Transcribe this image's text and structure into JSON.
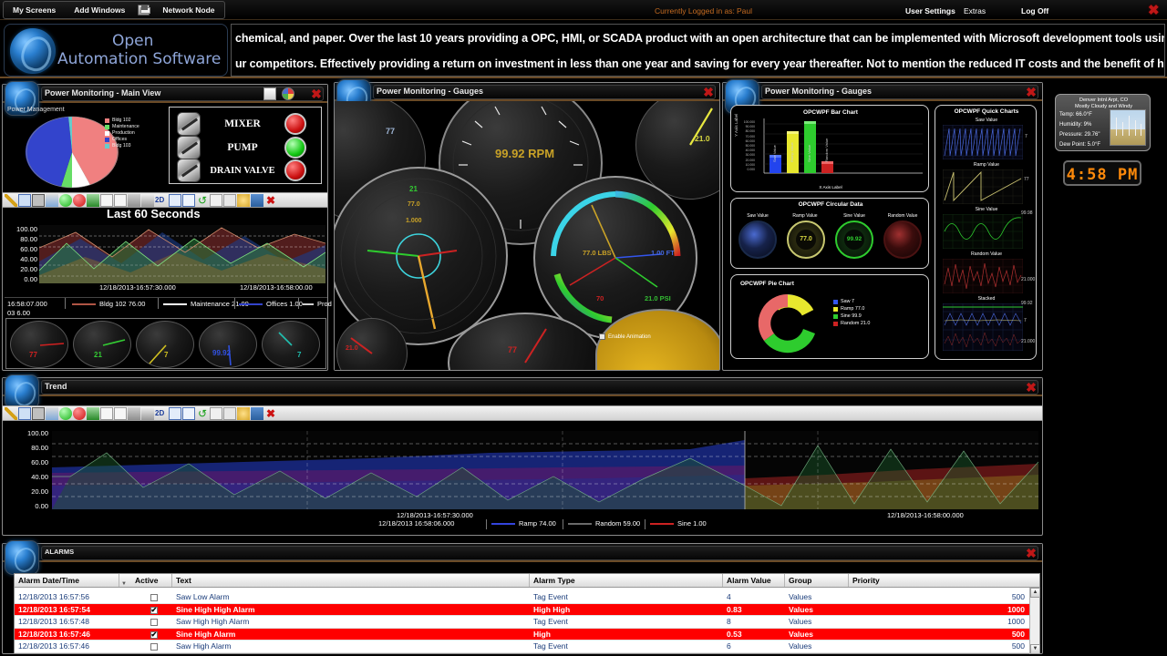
{
  "topbar": {
    "menu": [
      {
        "label": "My Screens",
        "icon": "none"
      },
      {
        "label": "Add Windows",
        "icon": "none"
      },
      {
        "label": "Network Node",
        "icon": "save-icon"
      }
    ],
    "logged_in_label": "Currently Logged in as:",
    "logged_in_user": "Paul",
    "right_items": [
      {
        "label": "User Settings"
      },
      {
        "label": "Extras"
      },
      {
        "label": "Log Off"
      }
    ],
    "close_icon": "close-icon"
  },
  "banner": {
    "logo_line1": "Open",
    "logo_line2": "Automation Software",
    "marquee_line1": "chemical, and paper. Over the last 10 years providing a OPC, HMI, or SCADA product with an open architecture that can be implemented with Microsoft development tools using VB.NET, C",
    "marquee_line2": "ur competitors. Effectively providing a return on investment in less than one year and saving for every year thereafter. Not to mention the reduced IT costs and the benefit of have access t"
  },
  "windows": {
    "main_view": {
      "title": "Power Monitoring - Main View",
      "section_label": "Power Management",
      "pie": {
        "title": "Power Management",
        "legend": [
          {
            "label": "Bldg 102",
            "color": "#f08080"
          },
          {
            "label": "Maintenance",
            "color": "#66dd66"
          },
          {
            "label": "Production",
            "color": "#ffffff"
          },
          {
            "label": "Offices",
            "color": "#3344cc"
          },
          {
            "label": "Bldg 103",
            "color": "#66cccc"
          }
        ]
      },
      "indicators": [
        {
          "name": "MIXER",
          "state": "red"
        },
        {
          "name": "PUMP",
          "state": "green"
        },
        {
          "name": "DRAIN VALVE",
          "state": "red"
        }
      ],
      "trend": {
        "title": "Last 60 Seconds",
        "y_ticks": [
          "100.00",
          "80.00",
          "60.00",
          "40.00",
          "20.00",
          "0.00"
        ],
        "x_ticks": [
          "12/18/2013-16:57:30.000",
          "12/18/2013-16:58:00.00"
        ],
        "legend_time": "16:58:07.000",
        "legend_time2": "03 6.00",
        "legend": [
          {
            "label": "Bldg 102 76.00",
            "color": "#b05545"
          },
          {
            "label": "Maintenance 21.00",
            "color": "#ffffff"
          },
          {
            "label": "Offices 1.00",
            "color": "#3344cc"
          },
          {
            "label": "Prod",
            "color": "#cfcfcf"
          }
        ]
      },
      "mini_gauges": [
        {
          "value": "77",
          "color": "#d02020"
        },
        {
          "value": "21",
          "color": "#33cc33"
        },
        {
          "value": "7",
          "color": "#d0c020"
        },
        {
          "value": "99.92",
          "color": "#3050e0"
        },
        {
          "value": "7",
          "color": "#20c0b0"
        }
      ]
    },
    "gauges_center": {
      "title": "Power Monitoring - Gauges",
      "rpm_value": "99.92 RPM",
      "readouts": [
        {
          "label": "77.0 LBS",
          "color": "#c9a227"
        },
        {
          "label": "1.00 FT",
          "color": "#4466dd"
        },
        {
          "label": "70",
          "color": "#cc2222"
        },
        {
          "label": "21.0 PSI",
          "color": "#33bb33"
        }
      ],
      "corner_values": [
        {
          "value": "77",
          "color": "#9fb6d6"
        },
        {
          "value": "21.0",
          "color": "#d8d840"
        },
        {
          "value": "21",
          "color": "#33cc33"
        },
        {
          "value": "77.0",
          "color": "#c9a227"
        },
        {
          "value": "1.000",
          "color": "#c9a227"
        },
        {
          "value": "77",
          "color": "#cc2222"
        },
        {
          "value": "21.0",
          "color": "#cc2222"
        },
        {
          "value": "77",
          "color": "#cc2222"
        }
      ],
      "animation_checkbox": "Enable Animation"
    },
    "gauges_right": {
      "title": "Power Monitoring - Gauges",
      "bar_chart": {
        "title": "OPCWPF Bar Chart",
        "x_label": "X Axis Label",
        "y_label": "Y Axis Label",
        "categories": [
          "Saw Value",
          "Ramp Value",
          "Sine Value",
          "Random Value"
        ],
        "values": [
          7,
          77,
          99.92,
          21
        ],
        "colors": [
          "#2244ee",
          "#e8e82e",
          "#2ecc2e",
          "#cc2222"
        ],
        "y_ticks": [
          "100.000",
          "90.000",
          "80.000",
          "70.000",
          "60.000",
          "50.000",
          "40.000",
          "30.000",
          "20.000",
          "10.000",
          "0.000"
        ]
      },
      "circular": {
        "title": "OPCWPF Circular Data",
        "items": [
          {
            "label": "Saw Value",
            "value": "7",
            "color": "#3355ee"
          },
          {
            "label": "Ramp Value",
            "value": "77.0",
            "color": "#d8d840"
          },
          {
            "label": "Sine Value",
            "value": "99.92",
            "color": "#2ecc2e"
          },
          {
            "label": "Random Value",
            "value": "21.0",
            "color": "#cc2222"
          }
        ]
      },
      "pie": {
        "title": "OPCWPF Pie Chart",
        "legend": [
          {
            "label": "Saw 7",
            "color": "#3355ee",
            "value": 7
          },
          {
            "label": "Ramp 77.0",
            "color": "#e8e82e",
            "value": 77
          },
          {
            "label": "Sine 99.9",
            "color": "#2ecc2e",
            "value": 99.9
          },
          {
            "label": "Random 21.0",
            "color": "#cc2222",
            "value": 21
          }
        ]
      },
      "quick_charts": {
        "title": "OPCWPF Quick Charts",
        "items": [
          {
            "label": "Saw Value",
            "value": "7",
            "color": "#4a6ae0"
          },
          {
            "label": "Ramp Value",
            "value": "77",
            "color": "#c8c070"
          },
          {
            "label": "Sine Value",
            "value": "99.98",
            "color": "#2ecc2e"
          },
          {
            "label": "Random Value",
            "value": "21.000",
            "color": "#b03030"
          },
          {
            "label": "Stacked",
            "values": [
              "99.92",
              "7",
              "21.000"
            ],
            "color": "#2ecc2e"
          }
        ]
      }
    },
    "trend": {
      "title": "Trend",
      "y_ticks": [
        "100.00",
        "80.00",
        "60.00",
        "40.00",
        "20.00",
        "0.00"
      ],
      "x_ticks": [
        "12/18/2013-16:57:30.000",
        "12/18/2013-16:58:00.000"
      ],
      "legend_time": "12/18/2013 16:58:06.000",
      "legend": [
        {
          "label": "Ramp 74.00",
          "color": "#3344dd"
        },
        {
          "label": "Random 59.00",
          "color": "#6a6a6a"
        },
        {
          "label": "Sine 1.00",
          "color": "#cc2222"
        }
      ]
    },
    "alarms": {
      "title": "ALARMS",
      "columns": [
        "Alarm Date/Time",
        "Active",
        "Text",
        "Alarm Type",
        "Alarm Value",
        "Group",
        "Priority"
      ],
      "sort_icon": "chevron-down-icon",
      "rows": [
        {
          "datetime": "12/18/2013 16:57:56",
          "active": false,
          "text": "Saw Low Alarm",
          "type": "Tag Event",
          "value": "4",
          "group": "Values",
          "priority": "500",
          "alarm": false
        },
        {
          "datetime": "12/18/2013 16:57:54",
          "active": true,
          "text": "Sine High High Alarm",
          "type": "High High",
          "value": "0.83",
          "group": "Values",
          "priority": "1000",
          "alarm": true
        },
        {
          "datetime": "12/18/2013 16:57:48",
          "active": false,
          "text": "Saw High High Alarm",
          "type": "Tag Event",
          "value": "8",
          "group": "Values",
          "priority": "1000",
          "alarm": false
        },
        {
          "datetime": "12/18/2013 16:57:46",
          "active": true,
          "text": "Sine High Alarm",
          "type": "High",
          "value": "0.53",
          "group": "Values",
          "priority": "500",
          "alarm": true
        },
        {
          "datetime": "12/18/2013 16:57:46",
          "active": false,
          "text": "Saw High Alarm",
          "type": "Tag Event",
          "value": "6",
          "group": "Values",
          "priority": "500",
          "alarm": false
        }
      ]
    }
  },
  "weather": {
    "station": "Denver Intnl Arpt, CO",
    "condition": "Mostly Cloudy and Windy",
    "temp": "Temp:  66.0°F",
    "humidity": "Humidity:  9%",
    "pressure": "Pressure:  29.76\"",
    "dew_point": "Dew Point:  5.0°F"
  },
  "clock": {
    "time": "4:58 PM"
  },
  "chart_data": [
    {
      "type": "pie",
      "title": "Power Management",
      "categories": [
        "Bldg 102",
        "Maintenance",
        "Production",
        "Offices",
        "Bldg 103"
      ],
      "values": [
        38,
        8,
        6,
        40,
        8
      ],
      "colors": [
        "#f08080",
        "#66dd66",
        "#ffffff",
        "#3344cc",
        "#66cccc"
      ]
    },
    {
      "type": "area",
      "title": "Last 60 Seconds",
      "xlabel": "",
      "ylabel": "",
      "ylim": [
        0,
        100
      ],
      "x": [
        "12/18/2013-16:57:30.000",
        "12/18/2013-16:58:00.000"
      ],
      "series": [
        {
          "name": "Bldg 102",
          "values": [
            76.0
          ],
          "color": "#b05545"
        },
        {
          "name": "Maintenance",
          "values": [
            21.0
          ],
          "color": "#ffffff"
        },
        {
          "name": "Offices",
          "values": [
            1.0
          ],
          "color": "#3344cc"
        },
        {
          "name": "Production",
          "values": [
            6.0
          ],
          "color": "#cfcfcf"
        }
      ]
    },
    {
      "type": "bar",
      "title": "OPCWPF Bar Chart",
      "xlabel": "X Axis Label",
      "ylabel": "Y Axis Label",
      "ylim": [
        0,
        100
      ],
      "categories": [
        "Saw Value",
        "Ramp Value",
        "Sine Value",
        "Random Value"
      ],
      "values": [
        7,
        77,
        99.92,
        21
      ],
      "colors": [
        "#2244ee",
        "#e8e82e",
        "#2ecc2e",
        "#cc2222"
      ]
    },
    {
      "type": "pie",
      "title": "OPCWPF Pie Chart",
      "categories": [
        "Saw",
        "Ramp",
        "Sine",
        "Random"
      ],
      "values": [
        7,
        77,
        99.9,
        21
      ],
      "colors": [
        "#3355ee",
        "#e8e82e",
        "#2ecc2e",
        "#cc2222"
      ]
    },
    {
      "type": "area",
      "title": "Trend",
      "xlabel": "",
      "ylabel": "",
      "ylim": [
        0,
        100
      ],
      "x": [
        "12/18/2013-16:57:30.000",
        "12/18/2013-16:58:00.000"
      ],
      "series": [
        {
          "name": "Ramp",
          "values": [
            74.0
          ],
          "color": "#3344dd"
        },
        {
          "name": "Random",
          "values": [
            59.0
          ],
          "color": "#6a6a6a"
        },
        {
          "name": "Sine",
          "values": [
            1.0
          ],
          "color": "#cc2222"
        }
      ]
    }
  ]
}
